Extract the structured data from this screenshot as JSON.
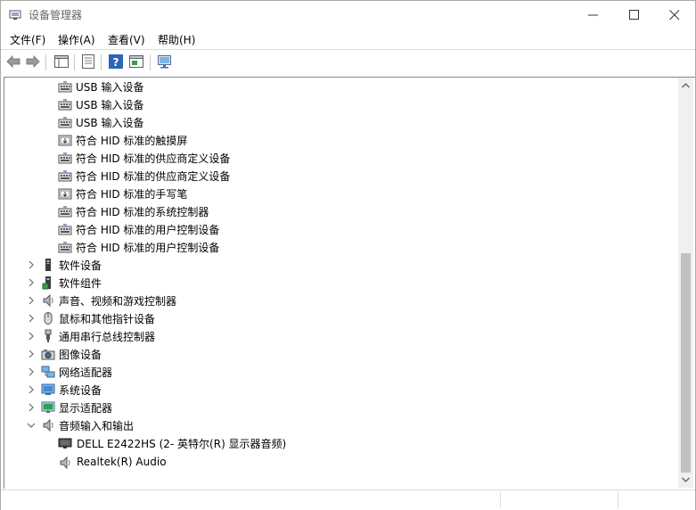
{
  "window": {
    "title": "设备管理器"
  },
  "menu": [
    {
      "label": "文件(F)"
    },
    {
      "label": "操作(A)"
    },
    {
      "label": "查看(V)"
    },
    {
      "label": "帮助(H)"
    }
  ],
  "tree": {
    "hid_children": [
      {
        "label": "USB 输入设备",
        "icon": "hid-device-icon"
      },
      {
        "label": "USB 输入设备",
        "icon": "hid-device-icon"
      },
      {
        "label": "USB 输入设备",
        "icon": "hid-device-icon"
      },
      {
        "label": "符合 HID 标准的触摸屏",
        "icon": "hid-touch-icon"
      },
      {
        "label": "符合 HID 标准的供应商定义设备",
        "icon": "hid-device-icon"
      },
      {
        "label": "符合 HID 标准的供应商定义设备",
        "icon": "hid-device-icon"
      },
      {
        "label": "符合 HID 标准的手写笔",
        "icon": "hid-touch-icon"
      },
      {
        "label": "符合 HID 标准的系统控制器",
        "icon": "hid-device-icon"
      },
      {
        "label": "符合 HID 标准的用户控制设备",
        "icon": "hid-device-icon"
      },
      {
        "label": "符合 HID 标准的用户控制设备",
        "icon": "hid-device-icon"
      }
    ],
    "categories": [
      {
        "label": "软件设备",
        "icon": "software-device-icon",
        "expanded": false
      },
      {
        "label": "软件组件",
        "icon": "software-component-icon",
        "expanded": false
      },
      {
        "label": "声音、视频和游戏控制器",
        "icon": "speaker-icon",
        "expanded": false
      },
      {
        "label": "鼠标和其他指针设备",
        "icon": "mouse-icon",
        "expanded": false
      },
      {
        "label": "通用串行总线控制器",
        "icon": "usb-icon",
        "expanded": false
      },
      {
        "label": "图像设备",
        "icon": "camera-icon",
        "expanded": false
      },
      {
        "label": "网络适配器",
        "icon": "network-adapter-icon",
        "expanded": false
      },
      {
        "label": "系统设备",
        "icon": "system-device-icon",
        "expanded": false
      },
      {
        "label": "显示适配器",
        "icon": "display-adapter-icon",
        "expanded": false
      },
      {
        "label": "音频输入和输出",
        "icon": "speaker-icon",
        "expanded": true
      }
    ],
    "audio_children": [
      {
        "label": "DELL E2422HS (2- 英特尔(R) 显示器音频)",
        "icon": "monitor-icon"
      },
      {
        "label": "Realtek(R) Audio",
        "icon": "speaker-icon"
      }
    ]
  },
  "colors": {
    "window_border": "#aaaaaa",
    "scroll_track": "#f0f0f0",
    "scroll_thumb": "#c1c1c1",
    "toolbar_icon_blue": "#2a65b8"
  }
}
